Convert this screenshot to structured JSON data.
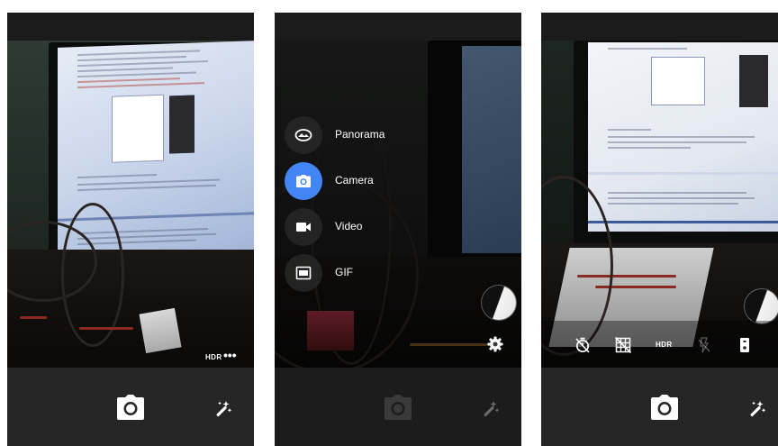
{
  "colors": {
    "accent": "#4285f4",
    "bar": "#262626",
    "status": "#1b1b1b"
  },
  "screen1": {
    "hdr_label": "HDR",
    "more_icon": "more-horiz-icon",
    "shutter_icon": "camera-shutter-icon",
    "effects_icon": "magic-wand-icon"
  },
  "screen2": {
    "modes": [
      {
        "label": "Panorama",
        "icon": "panorama-icon",
        "active": false
      },
      {
        "label": "Camera",
        "icon": "camera-icon",
        "active": true
      },
      {
        "label": "Video",
        "icon": "videocam-icon",
        "active": false
      },
      {
        "label": "GIF",
        "icon": "gif-icon",
        "active": false
      }
    ],
    "settings_icon": "gear-icon",
    "thumbnail_icon": "gallery-thumbnail"
  },
  "screen3": {
    "controls": [
      "timer-off-icon",
      "grid-off-icon",
      "hdr-text",
      "flash-off-icon",
      "switch-camera-icon"
    ],
    "hdr_label": "HDR",
    "shutter_icon": "camera-shutter-icon",
    "effects_icon": "magic-wand-icon",
    "thumbnail_icon": "gallery-thumbnail"
  }
}
